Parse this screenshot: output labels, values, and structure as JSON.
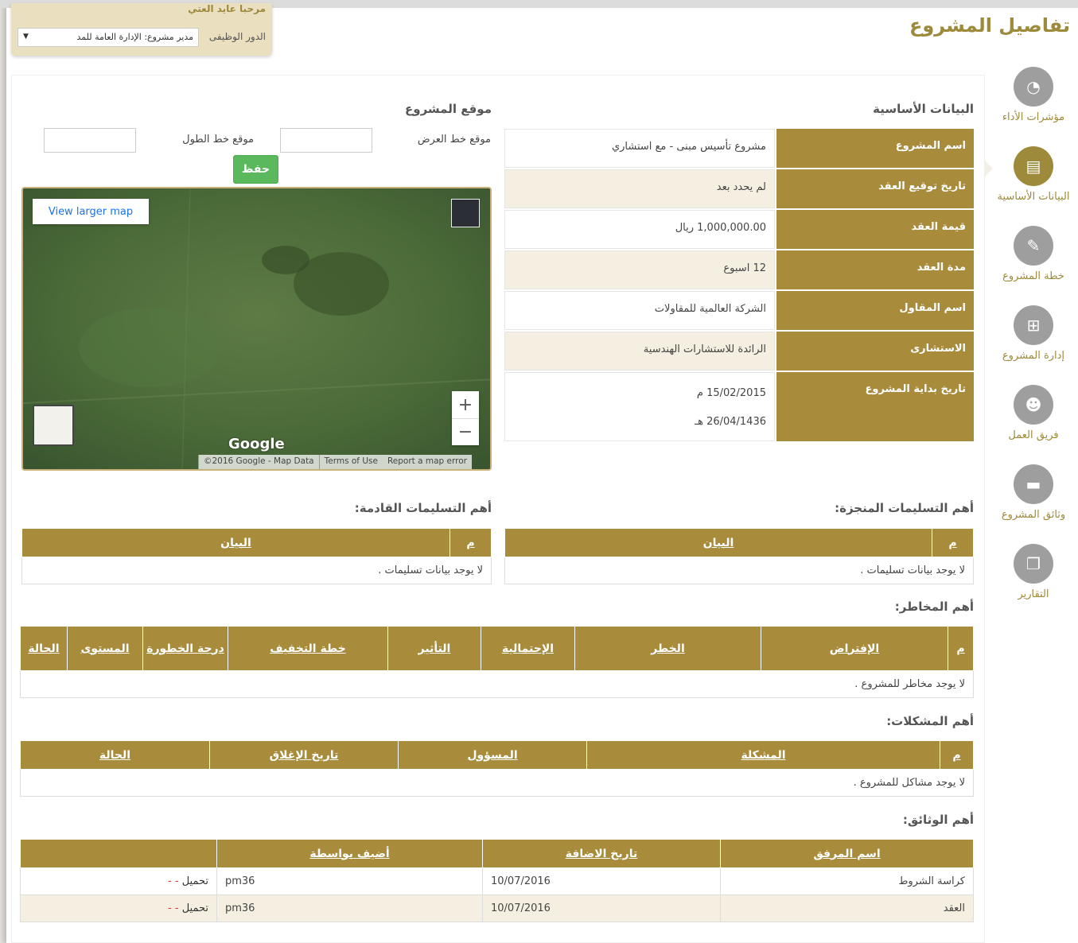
{
  "page_title": "تفاصيل المشروع",
  "user": {
    "welcome": "مرحبا عايد العتي",
    "role_label": "الدور الوظيفى",
    "role_value": "مدير مشروع: الإدارة العامة للمد",
    "role_arrow": "▼"
  },
  "nav": [
    {
      "label": "مؤشرات الأداء",
      "icon": "dashboard-icon",
      "glyph": "◔"
    },
    {
      "label": "البيانات الأساسية",
      "icon": "file-icon",
      "glyph": "▤"
    },
    {
      "label": "خطة المشروع",
      "icon": "edit-icon",
      "glyph": "✎"
    },
    {
      "label": "إدارة المشروع",
      "icon": "sitemap-icon",
      "glyph": "⊞"
    },
    {
      "label": "فريق العمل",
      "icon": "users-icon",
      "glyph": "☻"
    },
    {
      "label": "وثائق المشروع",
      "icon": "folder-open-icon",
      "glyph": "▬"
    },
    {
      "label": "التقارير",
      "icon": "copy-icon",
      "glyph": "❐"
    }
  ],
  "basic_info": {
    "title": "البيانات الأساسية",
    "rows": [
      {
        "key": "اسم المشروع",
        "value": "مشروع تأسيس مبنى - مع استشاري"
      },
      {
        "key": "تاريخ توقيع العقد",
        "value": "لم يحدد بعد"
      },
      {
        "key": "قيمة العقد",
        "value": "1,000,000.00 ريال"
      },
      {
        "key": "مدة العقد",
        "value": "12 اسبوع"
      },
      {
        "key": "اسم المقاول",
        "value": "الشركة العالمية للمقاولات"
      },
      {
        "key": "الاستشارى",
        "value": "الرائدة للاستشارات الهندسية"
      },
      {
        "key": "تاريخ بداية المشروع",
        "value": "15/02/2015 م",
        "value2": "26/04/1436 هـ"
      }
    ]
  },
  "location": {
    "title": "موقع المشروع",
    "lat_label": "موقع خط العرض",
    "lng_label": "موقع خط الطول",
    "save_label": "حفظ",
    "view_larger": "View larger map",
    "google": "Google",
    "footer": [
      "©2016 Google - Map Data",
      "Terms of Use",
      "Report a map error"
    ]
  },
  "deliverables_done": {
    "title": "أهم التسليمات المنجزة:",
    "headers": [
      "م",
      "البيان"
    ],
    "empty": "لا يوجد بيانات تسليمات ."
  },
  "deliverables_upcoming": {
    "title": "أهم التسليمات القادمة:",
    "headers": [
      "م",
      "البيان"
    ],
    "empty": "لا يوجد بيانات تسليمات ."
  },
  "risks": {
    "title": "أهم المخاطر:",
    "headers": [
      "م",
      "الإفتراض",
      "الخطر",
      "الإحتمالية",
      "التأثير",
      "خطة التخفيف",
      "درجة الخطورة",
      "المستوى",
      "الحالة"
    ],
    "empty": "لا يوجد مخاطر للمشروع ."
  },
  "issues": {
    "title": "أهم المشكلات:",
    "headers": [
      "م",
      "المشكلة",
      "المسؤول",
      "تاريخ الإغلاق",
      "الحالة"
    ],
    "empty": "لا يوجد مشاكل للمشروع ."
  },
  "documents": {
    "title": "أهم الوثائق:",
    "headers": [
      "اسم المرفق",
      "تاريخ الاضافة",
      "أضيف بواسطة",
      ""
    ],
    "rows": [
      {
        "name": "كراسة الشروط",
        "date": "10/07/2016",
        "by": "pm36",
        "download": "تحميل",
        "sep": "-",
        "delete": "-"
      },
      {
        "name": "العقد",
        "date": "10/07/2016",
        "by": "pm36",
        "download": "تحميل",
        "sep": "-",
        "delete": "-"
      }
    ]
  },
  "colors": {
    "gold": "#a88c3c",
    "active_nav": "#9d8a3a",
    "inactive_nav": "#9e9e9e",
    "save": "#5cb85c"
  }
}
